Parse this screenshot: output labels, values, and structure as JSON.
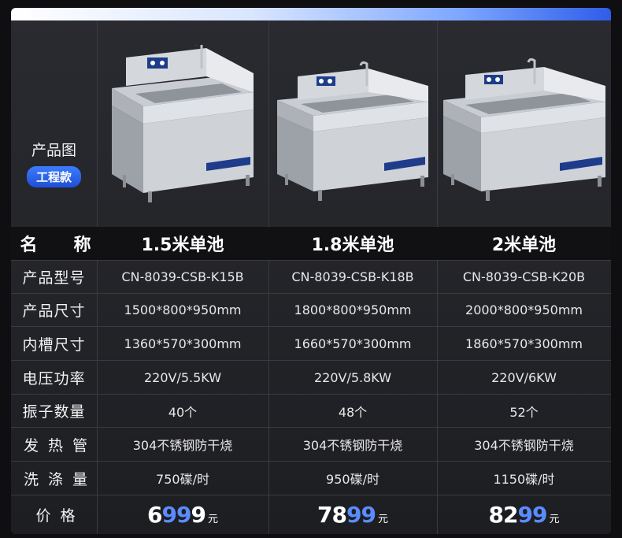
{
  "header": {
    "image_row_title": "产品图",
    "image_row_badge": "工程款"
  },
  "columns": [
    {
      "name": "1.5米单池",
      "model": "CN-8039-CSB-K15B",
      "size": "1500*800*950mm",
      "inner": "1360*570*300mm",
      "power": "220V/5.5KW",
      "vibrators": "40个",
      "heater": "304不锈钢防干烧",
      "capacity": "750碟/时",
      "price_prefix": "6",
      "price_blue": "99",
      "price_suffix": "9",
      "price_unit": "元"
    },
    {
      "name": "1.8米单池",
      "model": "CN-8039-CSB-K18B",
      "size": "1800*800*950mm",
      "inner": "1660*570*300mm",
      "power": "220V/5.8KW",
      "vibrators": "48个",
      "heater": "304不锈钢防干烧",
      "capacity": "950碟/时",
      "price_prefix": "78",
      "price_blue": "99",
      "price_suffix": "",
      "price_unit": "元"
    },
    {
      "name": "2米单池",
      "model": "CN-8039-CSB-K20B",
      "size": "2000*800*950mm",
      "inner": "1860*570*300mm",
      "power": "220V/6KW",
      "vibrators": "52个",
      "heater": "304不锈钢防干烧",
      "capacity": "1150碟/时",
      "price_prefix": "82",
      "price_blue": "99",
      "price_suffix": "",
      "price_unit": "元"
    }
  ],
  "row_labels": {
    "name": "名　称",
    "model": "产品型号",
    "size": "产品尺寸",
    "inner": "内槽尺寸",
    "power": "电压功率",
    "vibrators": "振子数量",
    "heater": "发热管",
    "capacity": "洗涤量",
    "price": "价格"
  },
  "colors": {
    "accent": "#3d7cff",
    "price_highlight": "#5a8cff"
  }
}
